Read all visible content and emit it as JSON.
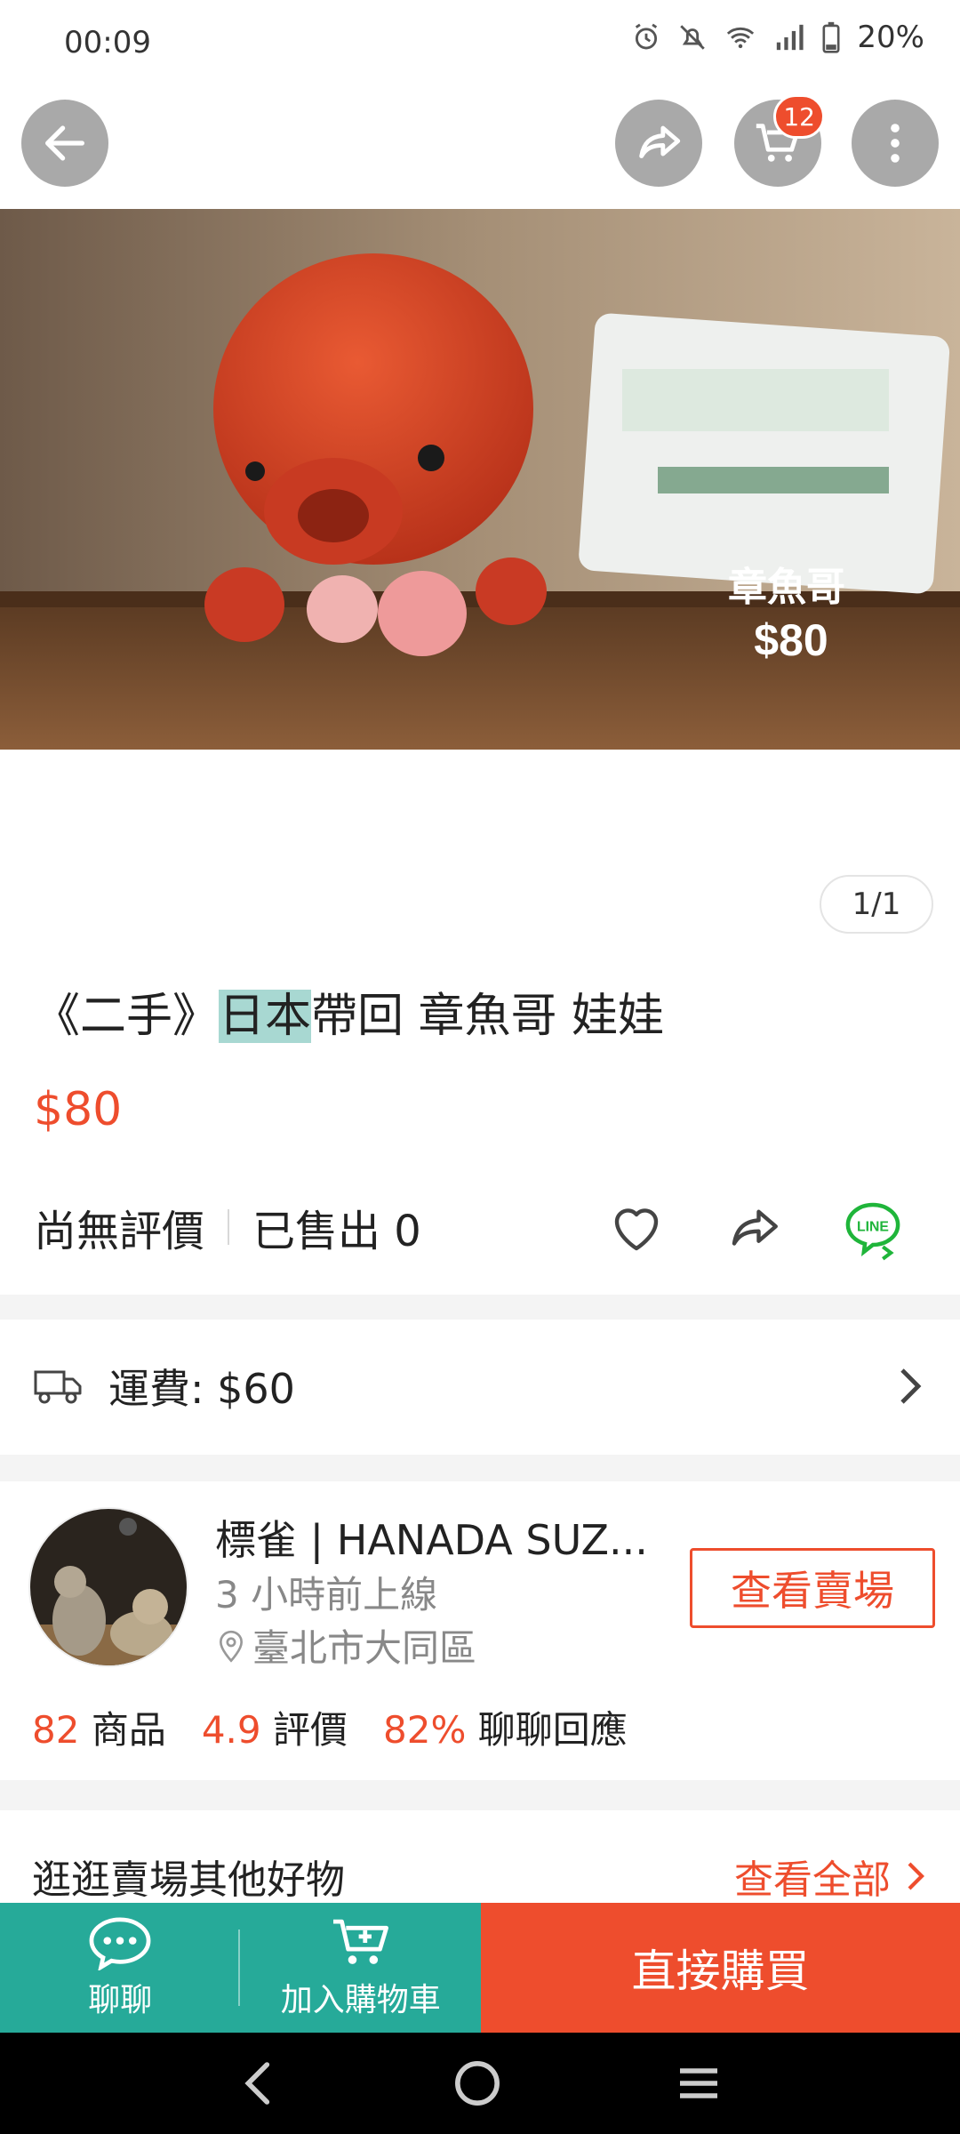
{
  "status_bar": {
    "time": "00:09",
    "battery": "20%"
  },
  "header": {
    "cart_count": "12"
  },
  "photo": {
    "overlay_name": "章魚哥",
    "overlay_price": "$80",
    "counter": "1/1"
  },
  "product": {
    "title_prefix": "《二手》",
    "title_highlight": "日本",
    "title_suffix": "帶回 章魚哥 娃娃",
    "price": "$80",
    "rating_text": "尚無評價",
    "sold_text": "已售出 0"
  },
  "shipping": {
    "label": "運費: $60"
  },
  "seller": {
    "name": "標雀 | HANADA SUZ...",
    "online": "3 小時前上線",
    "location": "臺北市大同區",
    "view_shop": "查看賣場",
    "stats": [
      {
        "num": "82",
        "label": "商品"
      },
      {
        "num": "4.9",
        "label": "評價"
      },
      {
        "num": "82%",
        "label": "聊聊回應"
      }
    ]
  },
  "more_goods": {
    "title": "逛逛賣場其他好物",
    "view_all": "查看全部"
  },
  "bottom_bar": {
    "chat": "聊聊",
    "add_cart": "加入購物車",
    "buy_now": "直接購買"
  },
  "colors": {
    "accent": "#ee4d2d",
    "teal": "#26aa99"
  },
  "icons": [
    "back-arrow-icon",
    "share-icon",
    "cart-icon",
    "more-vert-icon",
    "heart-icon",
    "line-share-icon",
    "truck-icon",
    "chevron-right-icon",
    "location-pin-icon",
    "chat-icon",
    "add-cart-icon"
  ]
}
